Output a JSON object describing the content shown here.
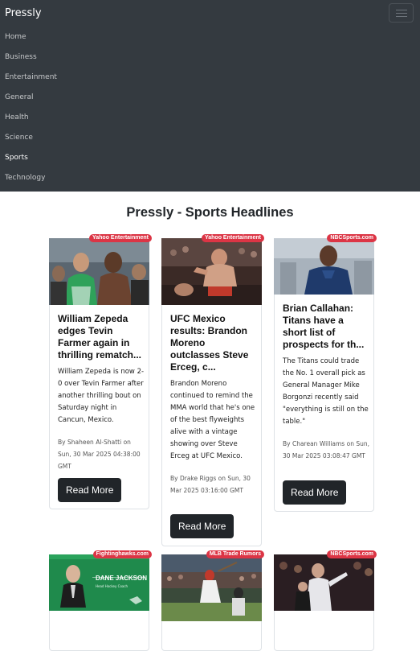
{
  "navbar": {
    "brand": "Pressly",
    "toggler_icon": "hamburger-icon",
    "items": [
      {
        "label": "Home"
      },
      {
        "label": "Business"
      },
      {
        "label": "Entertainment"
      },
      {
        "label": "General"
      },
      {
        "label": "Health"
      },
      {
        "label": "Science"
      },
      {
        "label": "Sports",
        "active": true
      },
      {
        "label": "Technology"
      }
    ]
  },
  "page": {
    "title": "Pressly - Sports Headlines"
  },
  "cards": [
    {
      "source": "Yahoo Entertainment",
      "title": "William Zepeda edges Tevin Farmer again in thrilling rematch...",
      "description": "William Zepeda is now 2-0 over Tevin Farmer after another thrilling bout on Saturday night in Cancun, Mexico.",
      "meta": "By Shaheen Al-Shatti on Sun, 30 Mar 2025 04:38:00 GMT",
      "button": "Read More"
    },
    {
      "source": "Yahoo Entertainment",
      "title": "UFC Mexico results: Brandon Moreno outclasses Steve Erceg, c...",
      "description": "Brandon Moreno continued to remind the MMA world that he's one of the best flyweights alive with a vintage showing over Steve Erceg at UFC Mexico.",
      "meta": "By Drake Riggs on Sun, 30 Mar 2025 03:16:00 GMT",
      "button": "Read More"
    },
    {
      "source": "NBCSports.com",
      "title": "Brian Callahan: Titans have a short list of prospects for th...",
      "description": "The Titans could trade the No. 1 overall pick as General Manager Mike Borgonzi recently said \"everything is still on the table.\"",
      "meta": "By Charean Williams on Sun, 30 Mar 2025 03:08:47 GMT",
      "button": "Read More"
    },
    {
      "source": "Fightinghawks.com",
      "image_text": "DANE JACKSON",
      "image_subtext": "Head Hockey Coach"
    },
    {
      "source": "MLB Trade Rumors"
    },
    {
      "source": "NBCSports.com"
    }
  ]
}
